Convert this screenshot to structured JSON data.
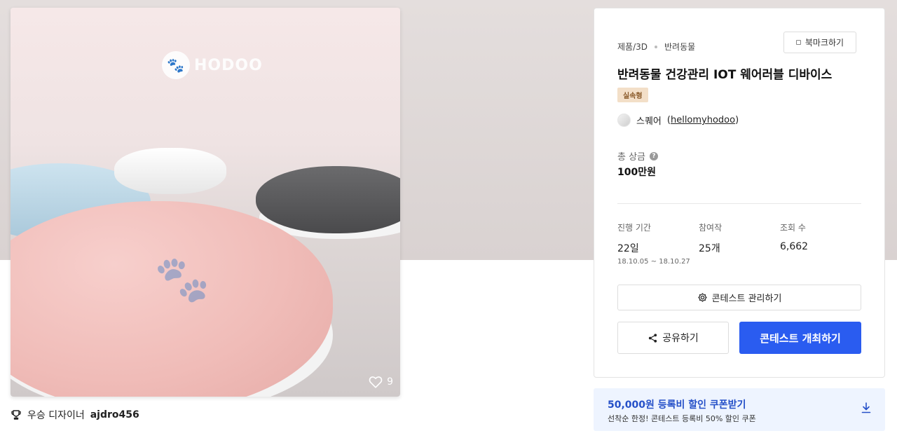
{
  "product": {
    "logo_text": "HODOO",
    "likes": "9"
  },
  "award": {
    "label": "우승 디자이너",
    "designer": "ajdro456"
  },
  "contest": {
    "category": "제품/3D",
    "subcategory": "반려동물",
    "bookmark_label": "북마크하기",
    "title": "반려동물 건강관리 IOT 웨어러블 디바이스",
    "type_badge": "실속형",
    "host_name": "스퀘어",
    "host_id": "hellomyhodoo",
    "prize_label": "총 상금",
    "prize_value": "100만원",
    "stats": {
      "period_label": "진행 기간",
      "period_value": "22일",
      "period_range": "18.10.05 ~ 18.10.27",
      "entries_label": "참여작",
      "entries_value": "25개",
      "views_label": "조회 수",
      "views_value": "6,662"
    },
    "manage_label": "콘테스트 관리하기",
    "share_label": "공유하기",
    "open_label": "콘테스트 개최하기"
  },
  "coupon": {
    "title": "50,000원 등록비 할인 쿠폰받기",
    "description": "선착순 한정! 콘테스트 등록비 50% 할인 쿠폰"
  },
  "colors": {
    "primary": "#2a5cf0",
    "coupon_bg": "#eef4ff",
    "badge_bg": "#f3dfc8"
  }
}
